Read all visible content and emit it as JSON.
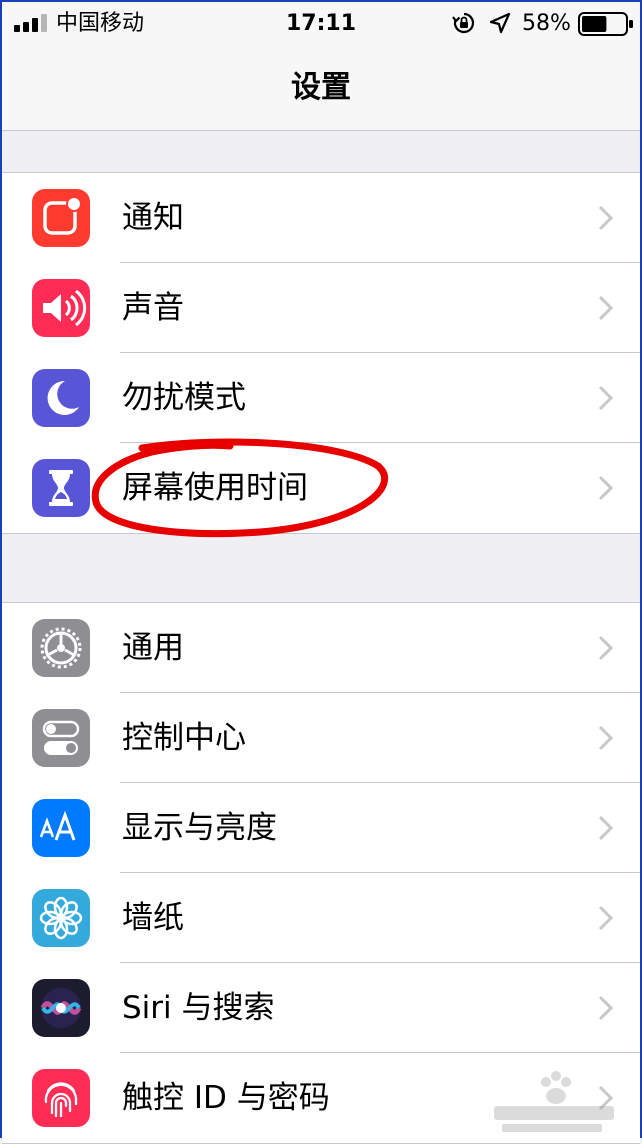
{
  "status_bar": {
    "carrier": "中国移动",
    "time": "17:11",
    "battery_percent": "58%",
    "battery_level": 0.58
  },
  "nav": {
    "title": "设置"
  },
  "groups": [
    {
      "items": [
        {
          "label": "通知",
          "icon": "notifications-icon",
          "color": "#ff3b30"
        },
        {
          "label": "声音",
          "icon": "sound-icon",
          "color": "#ff2d55"
        },
        {
          "label": "勿扰模式",
          "icon": "moon-icon",
          "color": "#5856d6"
        },
        {
          "label": "屏幕使用时间",
          "icon": "hourglass-icon",
          "color": "#5856d6"
        }
      ]
    },
    {
      "items": [
        {
          "label": "通用",
          "icon": "gear-icon",
          "color": "#8e8e93"
        },
        {
          "label": "控制中心",
          "icon": "toggles-icon",
          "color": "#8e8e93"
        },
        {
          "label": "显示与亮度",
          "icon": "text-size-icon",
          "color": "#007aff"
        },
        {
          "label": "墙纸",
          "icon": "flower-icon",
          "color": "#34aadc"
        },
        {
          "label": "Siri 与搜索",
          "icon": "siri-icon",
          "color": "#1c1c2e"
        },
        {
          "label": "触控 ID 与密码",
          "icon": "fingerprint-icon",
          "color": "#ff2d55"
        }
      ]
    }
  ],
  "annotation_color": "#e60000"
}
